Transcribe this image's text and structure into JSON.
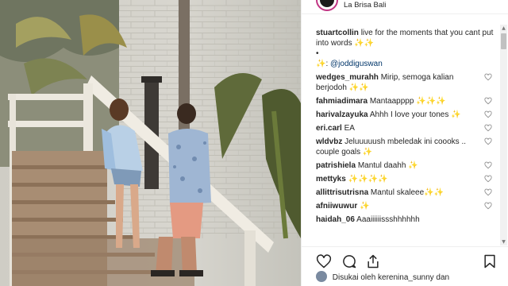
{
  "post": {
    "location": "La Brisa Bali"
  },
  "caption": {
    "username": "stuartcollin",
    "text": "live for the moments that you cant put into words ✨✨",
    "bullet": "•",
    "tag_prefix": "✨:",
    "tag": "@joddiguswan"
  },
  "comments": [
    {
      "username": "wedges_murahh",
      "text": "Mirip, semoga kalian berjodoh ✨✨"
    },
    {
      "username": "fahmiadimara",
      "text": "Mantaapppp ✨✨✨"
    },
    {
      "username": "harivalzayuka",
      "text": "Ahhh I love your tones ✨"
    },
    {
      "username": "eri.carl",
      "text": "EA"
    },
    {
      "username": "wldvbz",
      "text": "Jeluuuuush mbeledak ini coooks .. couple goals ✨"
    },
    {
      "username": "patrishiela",
      "text": "Mantul daahh ✨"
    },
    {
      "username": "mettyks",
      "text": "✨✨✨✨"
    },
    {
      "username": "allittrisutrisna",
      "text": "Mantul skaleee✨✨"
    },
    {
      "username": "afniiwuwur",
      "text": "✨"
    },
    {
      "username": "haidah_06",
      "text": "Aaaiiiiiissshhhhhh"
    }
  ],
  "likes": {
    "text": "Disukai oleh kerenina_sunny dan"
  },
  "icons": {
    "like": "heart-icon",
    "comment": "comment-icon",
    "share": "share-icon",
    "save": "bookmark-icon",
    "comment_like": "heart-small-icon"
  },
  "colors": {
    "story_ring": "#c13584",
    "link": "#003569",
    "text": "#262626"
  }
}
